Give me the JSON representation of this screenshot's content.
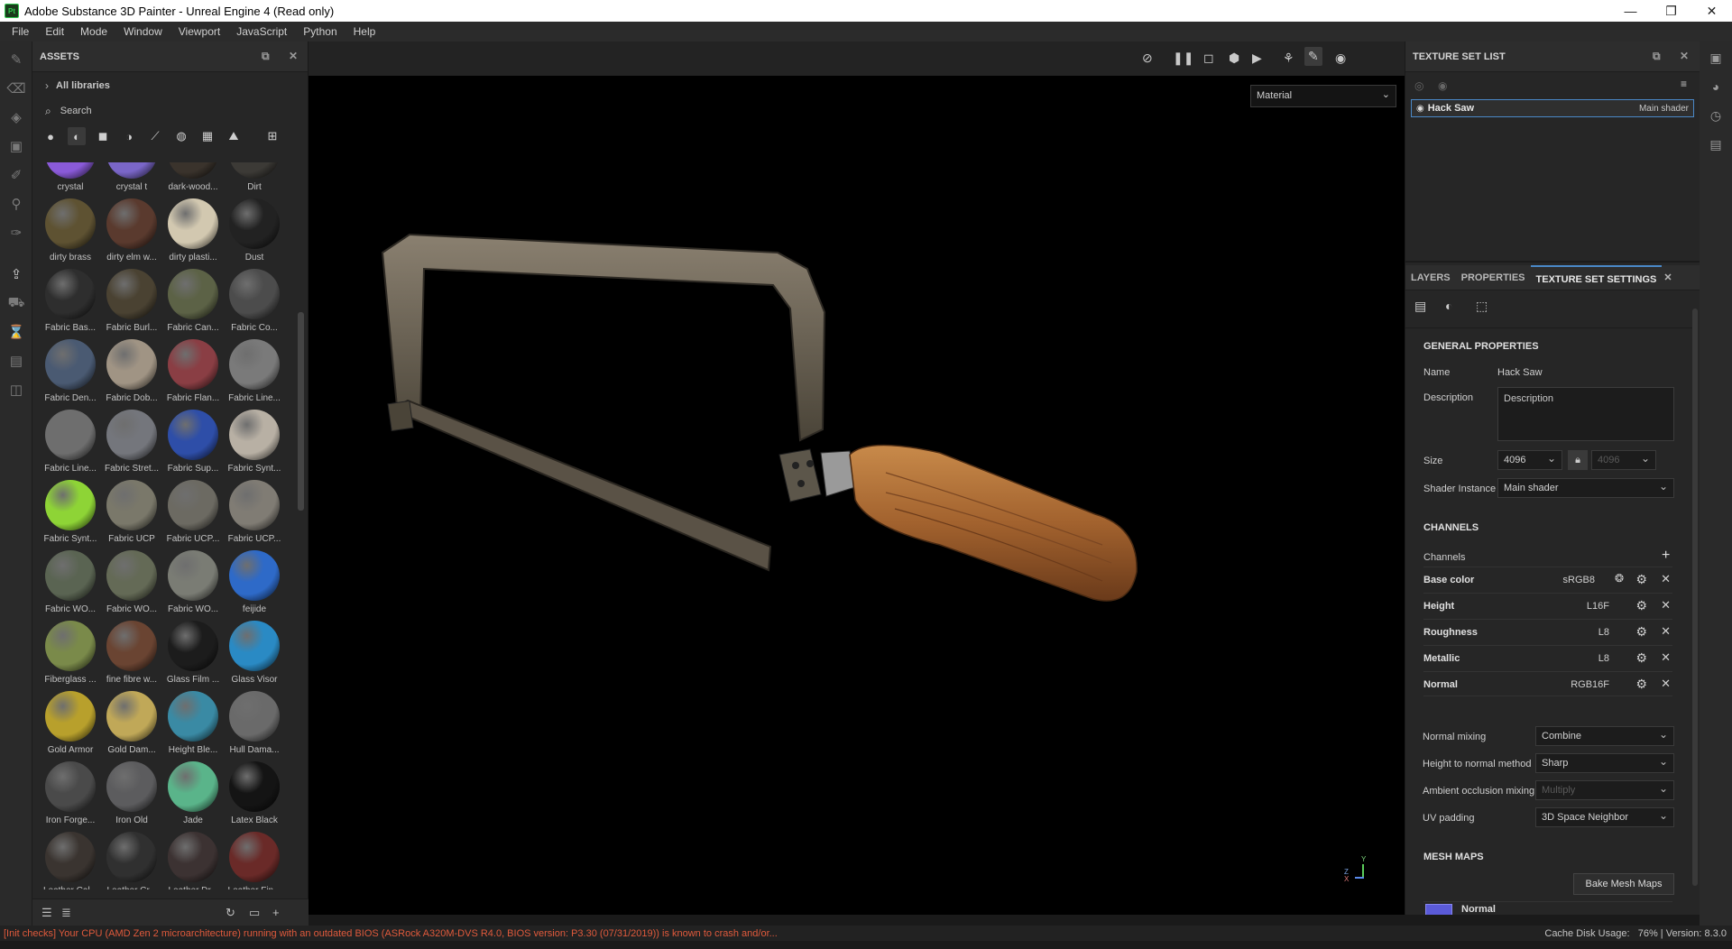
{
  "window": {
    "title": "Adobe Substance 3D Painter - Unreal Engine 4 (Read only)",
    "app_icon": "Pt"
  },
  "menu": [
    "File",
    "Edit",
    "Mode",
    "Window",
    "Viewport",
    "JavaScript",
    "Python",
    "Help"
  ],
  "assets": {
    "title": "ASSETS",
    "breadcrumb": "All libraries",
    "search_placeholder": "Search",
    "items": [
      {
        "label": "crystal",
        "color": "#8a5ad8"
      },
      {
        "label": "crystal t",
        "color": "#7a66c8"
      },
      {
        "label": "dark-wood...",
        "color": "#3a332c"
      },
      {
        "label": "Dirt",
        "color": "#3c3a36"
      },
      {
        "label": "dirty brass",
        "color": "#5e5232"
      },
      {
        "label": "dirty elm w...",
        "color": "#5a3a2e"
      },
      {
        "label": "dirty plasti...",
        "color": "#d2c8b0"
      },
      {
        "label": "Dust",
        "color": "#222222"
      },
      {
        "label": "Fabric Bas...",
        "color": "#2e2e2e"
      },
      {
        "label": "Fabric Burl...",
        "color": "#4a4232"
      },
      {
        "label": "Fabric Can...",
        "color": "#5c6246"
      },
      {
        "label": "Fabric Co...",
        "color": "#4c4c4c"
      },
      {
        "label": "Fabric Den...",
        "color": "#4a5a72"
      },
      {
        "label": "Fabric Dob...",
        "color": "#a09484"
      },
      {
        "label": "Fabric Flan...",
        "color": "#8a3e44"
      },
      {
        "label": "Fabric Line...",
        "color": "#7a7a7a"
      },
      {
        "label": "Fabric Line...",
        "color": "#6e6e6e"
      },
      {
        "label": "Fabric Stret...",
        "color": "#74767c"
      },
      {
        "label": "Fabric Sup...",
        "color": "#2e4ea8"
      },
      {
        "label": "Fabric Synt...",
        "color": "#b8b0a4"
      },
      {
        "label": "Fabric Synt...",
        "color": "#8ed436"
      },
      {
        "label": "Fabric UCP",
        "color": "#7a786a"
      },
      {
        "label": "Fabric UCP...",
        "color": "#6c6a62"
      },
      {
        "label": "Fabric UCP...",
        "color": "#807c74"
      },
      {
        "label": "Fabric WO...",
        "color": "#5a6452"
      },
      {
        "label": "Fabric WO...",
        "color": "#646a56"
      },
      {
        "label": "Fabric WO...",
        "color": "#7a7c74"
      },
      {
        "label": "feijide",
        "color": "#2e6ac8"
      },
      {
        "label": "Fiberglass ...",
        "color": "#7a8a4a"
      },
      {
        "label": "fine fibre w...",
        "color": "#6a4432"
      },
      {
        "label": "Glass Film ...",
        "color": "#1c1c1c"
      },
      {
        "label": "Glass Visor",
        "color": "#2a8ac4"
      },
      {
        "label": "Gold Armor",
        "color": "#b8a02c"
      },
      {
        "label": "Gold Dam...",
        "color": "#c0a858"
      },
      {
        "label": "Height Ble...",
        "color": "#3a8aa4"
      },
      {
        "label": "Hull Dama...",
        "color": "#6a6a6a"
      },
      {
        "label": "Iron Forge...",
        "color": "#4a4a4a"
      },
      {
        "label": "Iron Old",
        "color": "#5c5c5e"
      },
      {
        "label": "Jade",
        "color": "#5ab48a"
      },
      {
        "label": "Latex Black",
        "color": "#141414"
      },
      {
        "label": "Leather Cal...",
        "color": "#3a3430"
      },
      {
        "label": "Leather Cr...",
        "color": "#303030"
      },
      {
        "label": "Leather Dr...",
        "color": "#3c3232"
      },
      {
        "label": "Leather Fin...",
        "color": "#6a2a28"
      }
    ]
  },
  "viewport": {
    "mode_dropdown": "Material",
    "axis_labels": [
      "Y",
      "Z",
      "X"
    ]
  },
  "texture_set_list": {
    "title": "TEXTURE SET LIST",
    "item": {
      "name": "Hack Saw",
      "shader": "Main shader"
    }
  },
  "tabs": [
    {
      "label": "LAYERS",
      "active": false
    },
    {
      "label": "PROPERTIES",
      "active": false
    },
    {
      "label": "TEXTURE SET SETTINGS",
      "active": true
    }
  ],
  "settings": {
    "general_title": "GENERAL PROPERTIES",
    "name_label": "Name",
    "name_value": "Hack Saw",
    "description_label": "Description",
    "description_value": "Description",
    "size_label": "Size",
    "size_value": "4096",
    "size_value2": "4096",
    "shader_label": "Shader Instance",
    "shader_value": "Main shader",
    "channels_title": "CHANNELS",
    "channels_label": "Channels",
    "channels": [
      {
        "name": "Base color",
        "format": "sRGB8"
      },
      {
        "name": "Height",
        "format": "L16F"
      },
      {
        "name": "Roughness",
        "format": "L8"
      },
      {
        "name": "Metallic",
        "format": "L8"
      },
      {
        "name": "Normal",
        "format": "RGB16F"
      }
    ],
    "normal_mixing_label": "Normal mixing",
    "normal_mixing_value": "Combine",
    "height_to_normal_label": "Height to normal method",
    "height_to_normal_value": "Sharp",
    "ao_mixing_label": "Ambient occlusion mixing",
    "ao_mixing_value": "Multiply",
    "uv_padding_label": "UV padding",
    "uv_padding_value": "3D Space Neighbor",
    "mesh_maps_title": "MESH MAPS",
    "bake_button": "Bake Mesh Maps",
    "mesh_map_item": "Normal"
  },
  "status": {
    "error": "[Init checks] Your CPU (AMD Zen 2 microarchitecture) running with an outdated BIOS (ASRock A320M-DVS R4.0, BIOS version: P3.30 (07/31/2019)) is known to crash and/or...",
    "cache": "Cache Disk Usage:",
    "cache_value": "76%",
    "version": "Version: 8.3.0"
  },
  "colors": {
    "accent": "#4a88c7",
    "error": "#e05a3c"
  }
}
